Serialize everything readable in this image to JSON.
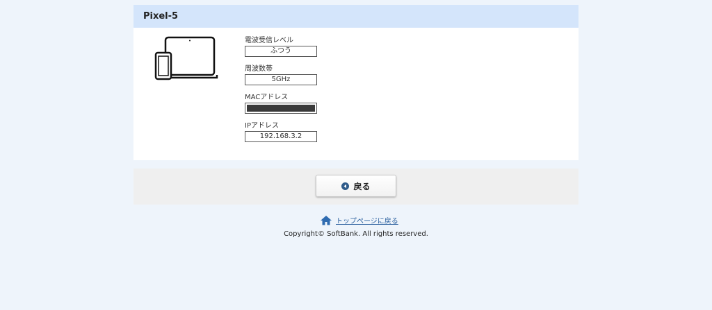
{
  "device": {
    "name": "Pixel-5"
  },
  "fields": [
    {
      "label": "電波受信レベル",
      "value": "ふつう"
    },
    {
      "label": "周波数帯",
      "value": "5GHz"
    },
    {
      "label": "MACアドレス",
      "value": ""
    },
    {
      "label": "IPアドレス",
      "value": "192.168.3.2"
    }
  ],
  "actions": {
    "back_label": "戻る",
    "top_link_label": "トップページに戻る"
  },
  "footer": {
    "copyright": "Copyright© SoftBank. All rights reserved."
  },
  "icons": {
    "device": "laptop-phone-icon",
    "back": "back-arrow-icon",
    "home": "home-icon"
  },
  "colors": {
    "background": "#eef4fb",
    "header": "#d4e5fb",
    "action_bar": "#efefef",
    "link": "#2a5f9e",
    "accent": "#2f5b8a"
  }
}
